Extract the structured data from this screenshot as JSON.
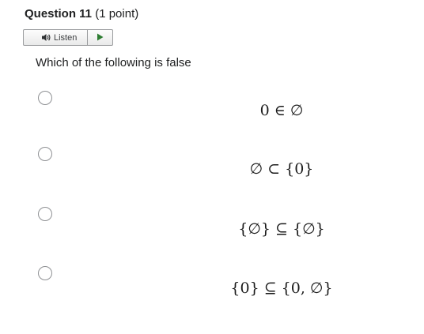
{
  "question": {
    "number_label": "Question 11",
    "points_label": "(1 point)"
  },
  "listen": {
    "label": "Listen"
  },
  "prompt": "Which of the following is false",
  "options": [
    {
      "text": "0 ∈ ∅"
    },
    {
      "text": "∅ ⊂ {0}"
    },
    {
      "text": "{∅} ⊆ {∅}"
    },
    {
      "text": "{0} ⊆ {0, ∅}"
    }
  ],
  "icons": {
    "speaker": "speaker-icon",
    "play": "play-icon"
  },
  "colors": {
    "play_green": "#2e7d32",
    "radio_border": "#8e9093",
    "text": "#202122"
  }
}
